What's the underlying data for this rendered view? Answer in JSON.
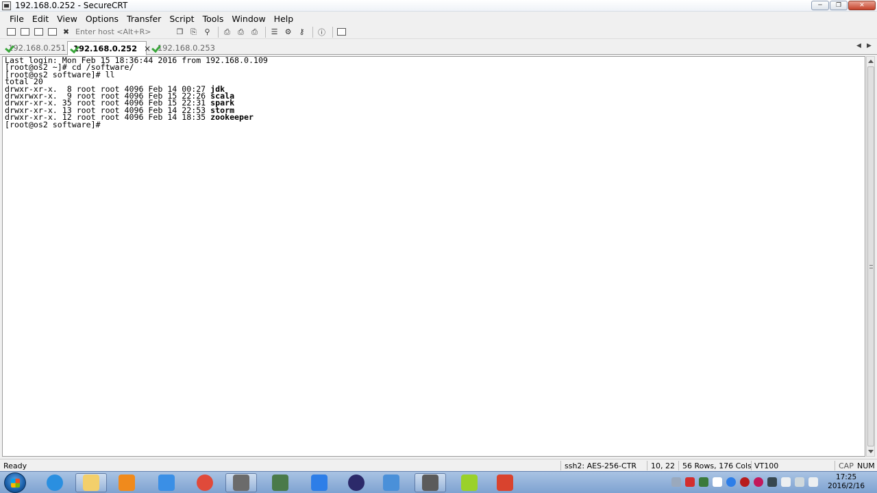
{
  "window": {
    "title": "192.168.0.252 - SecureCRT"
  },
  "menu": [
    "File",
    "Edit",
    "View",
    "Options",
    "Transfer",
    "Script",
    "Tools",
    "Window",
    "Help"
  ],
  "toolbar": {
    "host_placeholder": "Enter host <Alt+R>"
  },
  "tabs": [
    {
      "label": "192.168.0.251",
      "active": false
    },
    {
      "label": "192.168.0.252",
      "active": true,
      "close": "×"
    },
    {
      "label": "192.168.0.253",
      "active": false
    }
  ],
  "terminal": {
    "lines": [
      {
        "text": "Last login: Mon Feb 15 18:36:44 2016 from 192.168.0.109"
      },
      {
        "text": "[root@os2 ~]# cd /software/"
      },
      {
        "text": "[root@os2 software]# ll"
      },
      {
        "text": "total 20"
      },
      {
        "text": "drwxr-xr-x.  8 root root 4096 Feb 14 00:27 ",
        "bold": "jdk"
      },
      {
        "text": "drwxrwxr-x.  9 root root 4096 Feb 15 22:26 ",
        "bold": "scala"
      },
      {
        "text": "drwxr-xr-x. 35 root root 4096 Feb 15 22:31 ",
        "bold": "spark"
      },
      {
        "text": "drwxr-xr-x. 13 root root 4096 Feb 14 22:53 ",
        "bold": "storm"
      },
      {
        "text": "drwxr-xr-x. 12 root root 4096 Feb 14 18:35 ",
        "bold": "zookeeper"
      },
      {
        "text": "[root@os2 software]#"
      }
    ]
  },
  "status": {
    "ready": "Ready",
    "cipher": "ssh2: AES-256-CTR",
    "cursor": "10,  22",
    "size": "56 Rows, 176 Cols",
    "emulation": "VT100",
    "cap": "CAP",
    "num": "NUM"
  },
  "taskbar": {
    "clock_time": "17:25",
    "clock_date": "2016/2/16",
    "apps": [
      {
        "icon": "internet-explorer-icon",
        "color": "#2a8fe0"
      },
      {
        "icon": "folder-icon",
        "color": "#f3cf6b"
      },
      {
        "icon": "media-player-icon",
        "color": "#f08a1c"
      },
      {
        "icon": "baidu-cloud-icon",
        "color": "#3a8fe6"
      },
      {
        "icon": "chrome-icon",
        "color": "#e04a3a"
      },
      {
        "icon": "securecrt-icon",
        "color": "#6b6b6b"
      },
      {
        "icon": "securefx-icon",
        "color": "#4a7a4a"
      },
      {
        "icon": "pencil-app-icon",
        "color": "#2d7ee8"
      },
      {
        "icon": "eclipse-icon",
        "color": "#2c2a6a"
      },
      {
        "icon": "virtualbox-icon",
        "color": "#4a90d9"
      },
      {
        "icon": "securecrt-window-icon",
        "color": "#5b5b5b"
      },
      {
        "icon": "m-app-icon",
        "color": "#9ad12a"
      },
      {
        "icon": "foxit-reader-icon",
        "color": "#d9432e"
      }
    ]
  }
}
